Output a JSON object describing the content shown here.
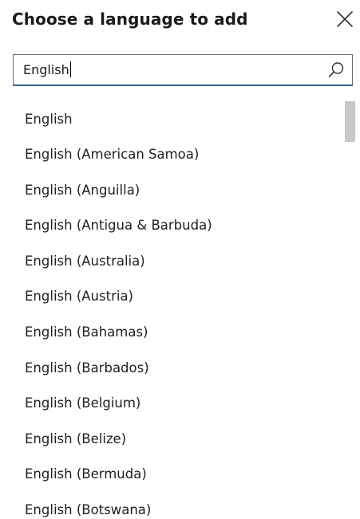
{
  "dialog": {
    "title": "Choose a language to add",
    "close_icon": "close-icon"
  },
  "search": {
    "value": "English",
    "placeholder": "",
    "icon": "search-icon"
  },
  "languages": {
    "items": [
      "English",
      "English (American Samoa)",
      "English (Anguilla)",
      "English (Antigua & Barbuda)",
      "English (Australia)",
      "English (Austria)",
      "English (Bahamas)",
      "English (Barbados)",
      "English (Belgium)",
      "English (Belize)",
      "English (Bermuda)",
      "English (Botswana)"
    ]
  },
  "colors": {
    "search_focus_border": "#3b5b8e",
    "scroll_thumb": "#c8c8c8"
  }
}
